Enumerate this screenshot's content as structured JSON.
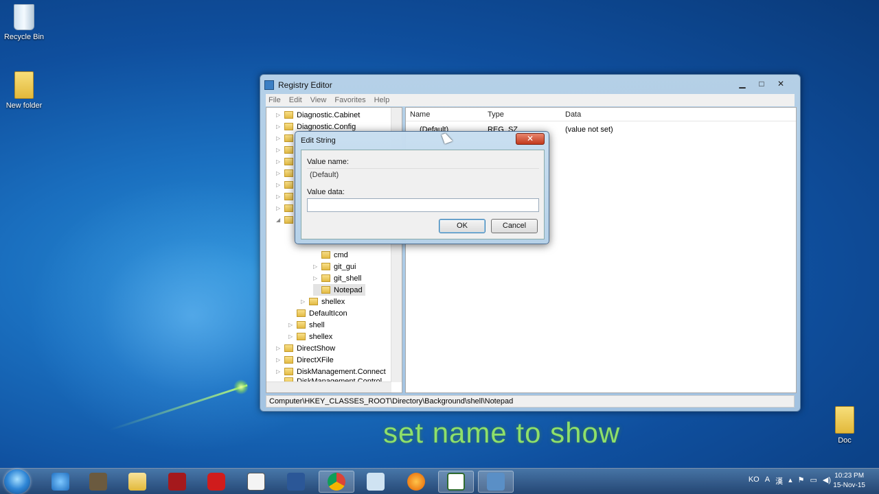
{
  "desktop": {
    "icons": [
      {
        "label": "Recycle Bin"
      },
      {
        "label": "New folder"
      },
      {
        "label": "Doc"
      }
    ],
    "caption": "set name to show"
  },
  "regedit": {
    "title": "Registry Editor",
    "menu": [
      "File",
      "Edit",
      "View",
      "Favorites",
      "Help"
    ],
    "tree": [
      {
        "label": "Diagnostic.Cabinet",
        "level": 0
      },
      {
        "label": "Diagnostic.Config",
        "level": 0
      },
      {
        "label": "cmd",
        "level": 3
      },
      {
        "label": "git_gui",
        "level": 3
      },
      {
        "label": "git_shell",
        "level": 3
      },
      {
        "label": "Notepad",
        "level": 3,
        "selected": true
      },
      {
        "label": "shellex",
        "level": 2
      },
      {
        "label": "DefaultIcon",
        "level": 1
      },
      {
        "label": "shell",
        "level": 1
      },
      {
        "label": "shellex",
        "level": 1
      },
      {
        "label": "DirectShow",
        "level": 0
      },
      {
        "label": "DirectXFile",
        "level": 0
      },
      {
        "label": "DiskManagement.Connect",
        "level": 0
      },
      {
        "label": "DiskManagement.Control",
        "level": 0
      }
    ],
    "columns": {
      "name": "Name",
      "type": "Type",
      "data": "Data"
    },
    "values": [
      {
        "name": "(Default)",
        "type": "REG_SZ",
        "data": "(value not set)"
      }
    ],
    "status_path": "Computer\\HKEY_CLASSES_ROOT\\Directory\\Background\\shell\\Notepad"
  },
  "edit_string": {
    "title": "Edit String",
    "value_name_label": "Value name:",
    "value_name": "(Default)",
    "value_data_label": "Value data:",
    "value_data": "",
    "ok": "OK",
    "cancel": "Cancel"
  },
  "taskbar": {
    "apps": [
      "internet-explorer",
      "app-1",
      "file-explorer",
      "book-app",
      "red-c-app",
      "calendar-app",
      "word",
      "chrome",
      "paint",
      "firefox",
      "c-editor",
      "regedit"
    ],
    "tray": [
      "KO",
      "A",
      "漢"
    ],
    "time": "10:23 PM",
    "date": "15-Nov-15"
  }
}
